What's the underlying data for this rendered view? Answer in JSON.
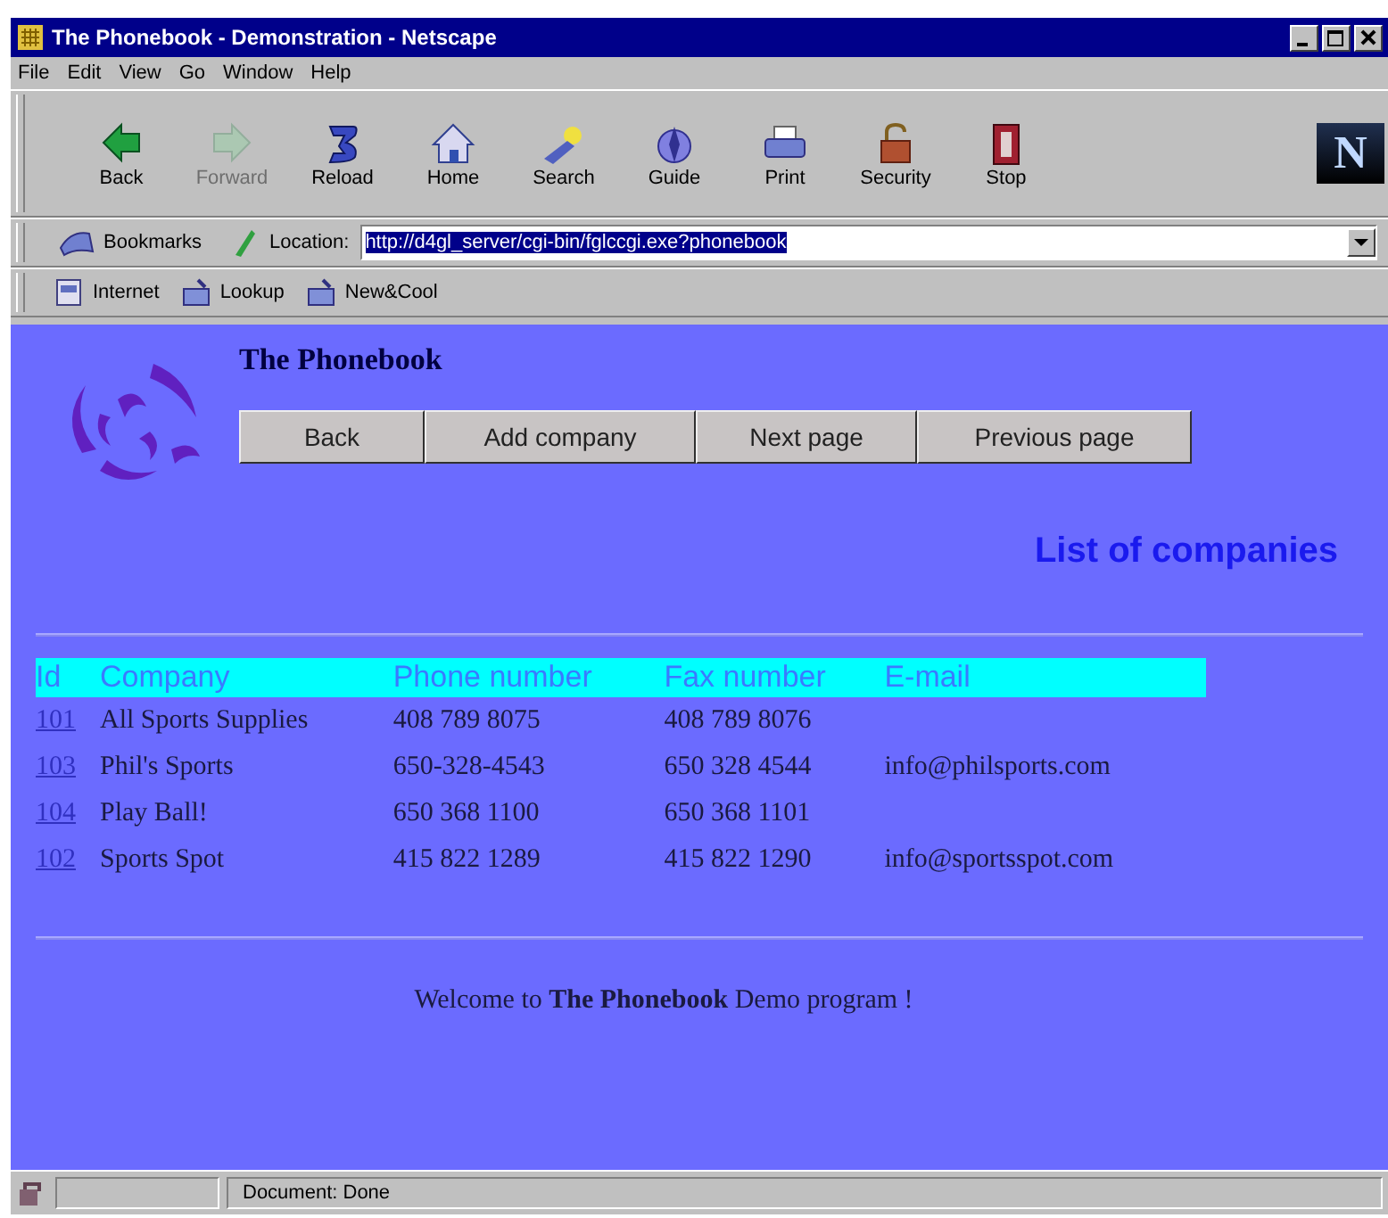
{
  "window": {
    "title": "The Phonebook - Demonstration - Netscape"
  },
  "menu": [
    "File",
    "Edit",
    "View",
    "Go",
    "Window",
    "Help"
  ],
  "toolbar": [
    {
      "label": "Back",
      "disabled": false
    },
    {
      "label": "Forward",
      "disabled": true
    },
    {
      "label": "Reload",
      "disabled": false
    },
    {
      "label": "Home",
      "disabled": false
    },
    {
      "label": "Search",
      "disabled": false
    },
    {
      "label": "Guide",
      "disabled": false
    },
    {
      "label": "Print",
      "disabled": false
    },
    {
      "label": "Security",
      "disabled": false
    },
    {
      "label": "Stop",
      "disabled": false
    }
  ],
  "throbber": "N",
  "location_bar": {
    "bookmarks": "Bookmarks",
    "label": "Location:",
    "url": "http://d4gl_server/cgi-bin/fglccgi.exe?phonebook"
  },
  "personal_toolbar": [
    "Internet",
    "Lookup",
    "New&Cool"
  ],
  "page": {
    "title": "The Phonebook",
    "buttons": [
      "Back",
      "Add company",
      "Next page",
      "Previous page"
    ],
    "heading": "List of companies",
    "table": {
      "columns": [
        "Id",
        "Company",
        "Phone number",
        "Fax number",
        "E-mail"
      ],
      "rows": [
        [
          "101",
          "All Sports Supplies",
          "408 789 8075",
          "408 789 8076",
          ""
        ],
        [
          "103",
          "Phil's Sports",
          "650-328-4543",
          "650 328 4544",
          "info@philsports.com"
        ],
        [
          "104",
          "Play Ball!",
          "650 368 1100",
          "650 368 1101",
          ""
        ],
        [
          "102",
          "Sports Spot",
          "415 822 1289",
          "415 822 1290",
          "info@sportsspot.com"
        ]
      ]
    },
    "footer": "Welcome to **The Phonebook** Demo program !"
  },
  "status_bar": {
    "text": "Document: Done"
  }
}
